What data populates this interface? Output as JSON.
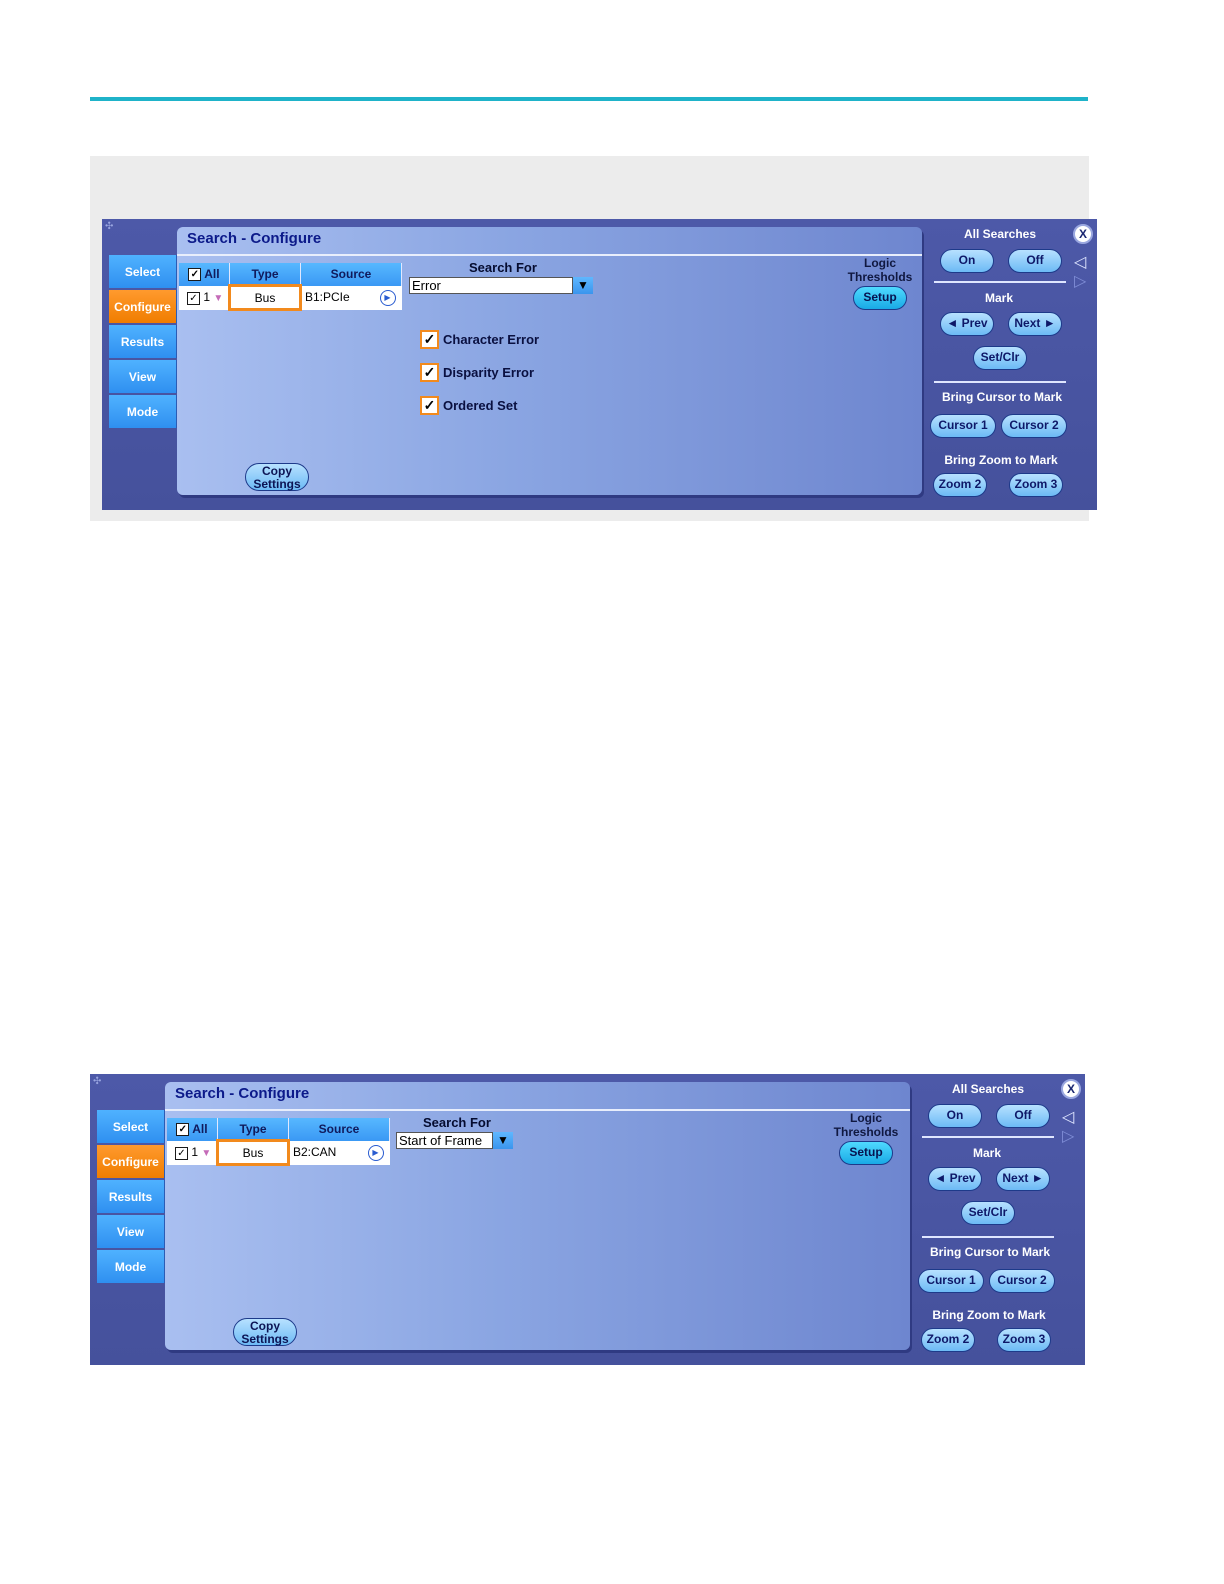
{
  "panels": [
    {
      "title": "Search - Configure",
      "tabs": [
        "Select",
        "Configure",
        "Results",
        "View",
        "Mode"
      ],
      "active_tab": "Configure",
      "grid": {
        "headers": {
          "all": "All",
          "type": "Type",
          "source": "Source"
        },
        "row": {
          "number": "1",
          "type": "Bus",
          "source": "B1:PCIe"
        }
      },
      "search_for_label": "Search For",
      "search_for_value": "Error",
      "checkboxes": [
        {
          "label": "Character Error",
          "checked": true
        },
        {
          "label": "Disparity Error",
          "checked": true
        },
        {
          "label": "Ordered Set",
          "checked": true
        }
      ],
      "logic_thresholds": {
        "line1": "Logic",
        "line2": "Thresholds",
        "button": "Setup"
      },
      "copy_settings": {
        "line1": "Copy",
        "line2": "Settings"
      },
      "side": {
        "all_searches": "All Searches",
        "on": "On",
        "off": "Off",
        "mark": "Mark",
        "prev": "◄ Prev",
        "next": "Next ►",
        "setclr": "Set/Clr",
        "bring_cursor": "Bring Cursor to Mark",
        "cursor1": "Cursor 1",
        "cursor2": "Cursor 2",
        "bring_zoom": "Bring Zoom to Mark",
        "zoom2": "Zoom 2",
        "zoom3": "Zoom 3",
        "close": "X"
      }
    },
    {
      "title": "Search - Configure",
      "tabs": [
        "Select",
        "Configure",
        "Results",
        "View",
        "Mode"
      ],
      "active_tab": "Configure",
      "grid": {
        "headers": {
          "all": "All",
          "type": "Type",
          "source": "Source"
        },
        "row": {
          "number": "1",
          "type": "Bus",
          "source": "B2:CAN"
        }
      },
      "search_for_label": "Search For",
      "search_for_value": "Start of Frame",
      "logic_thresholds": {
        "line1": "Logic",
        "line2": "Thresholds",
        "button": "Setup"
      },
      "copy_settings": {
        "line1": "Copy",
        "line2": "Settings"
      },
      "side": {
        "all_searches": "All Searches",
        "on": "On",
        "off": "Off",
        "mark": "Mark",
        "prev": "◄ Prev",
        "next": "Next ►",
        "setclr": "Set/Clr",
        "bring_cursor": "Bring Cursor to Mark",
        "cursor1": "Cursor 1",
        "cursor2": "Cursor 2",
        "bring_zoom": "Bring Zoom to Mark",
        "zoom2": "Zoom 2",
        "zoom3": "Zoom 3",
        "close": "X"
      }
    }
  ],
  "colors": {
    "accent_rule": "#1fb3c9",
    "active_tab": "#f07d00",
    "panel_bg": "#4d59a8"
  }
}
